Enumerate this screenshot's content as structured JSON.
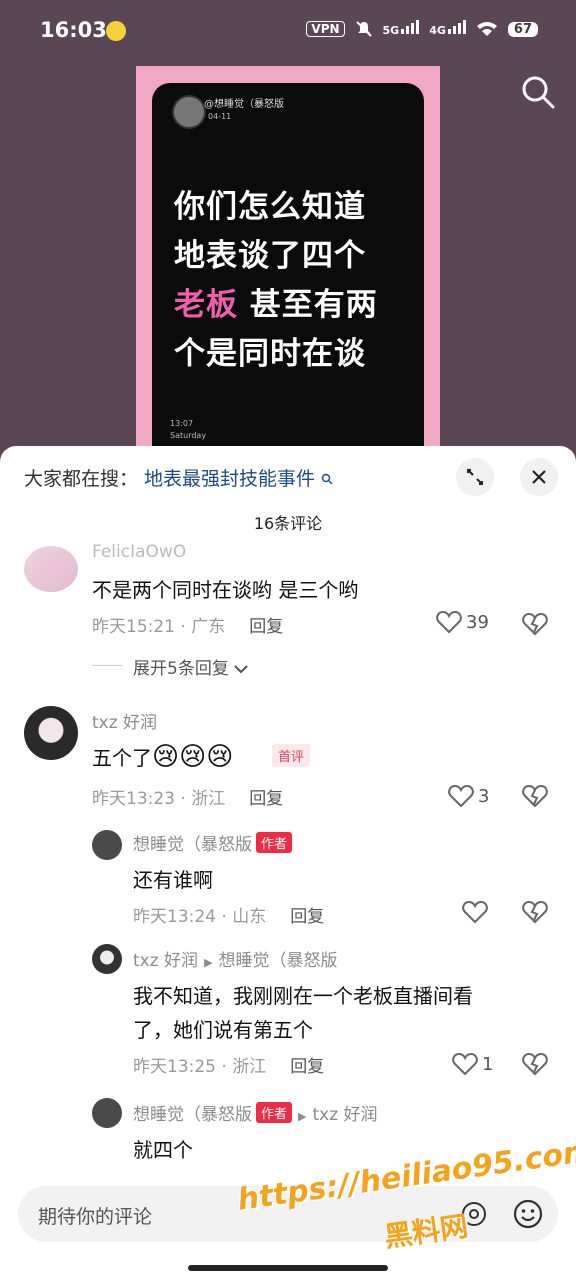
{
  "status": {
    "time": "16:03",
    "vpn": "VPN",
    "net1": "5G",
    "net2": "4G",
    "battery": "67"
  },
  "video": {
    "username": "@想睡觉（暴怒版",
    "date": "04-11",
    "lines": [
      "你们怎么知道",
      "地表谈了四个"
    ],
    "line3_pink": "老板",
    "line3_rest": "甚至有两",
    "line4": "个是同时在谈",
    "time": "13:07",
    "day": "Saturday"
  },
  "sheet": {
    "search_label": "大家都在搜：",
    "search_link": "地表最强封技能事件",
    "count": "16条评论"
  },
  "comments": [
    {
      "nick": "FelicIaOwO",
      "text": "不是两个同时在谈哟 是三个哟",
      "time": "昨天15:21 · 广东",
      "reply": "回复",
      "likes": "39",
      "expand": "展开5条回复"
    },
    {
      "nick": "txz 好润",
      "text": "五个了",
      "emoji": "😢😢😢",
      "badge": "首评",
      "time": "昨天13:23 · 浙江",
      "reply": "回复",
      "likes": "3"
    }
  ],
  "replies": [
    {
      "nick": "想睡觉（暴怒版",
      "badge": "作者",
      "text": "还有谁啊",
      "time": "昨天13:24 · 山东",
      "reply": "回复",
      "likes": ""
    },
    {
      "nick": "txz 好润",
      "to": "想睡觉（暴怒版",
      "text1": "我不知道，我刚刚在一个老板直播间看",
      "text2": "了，她们说有第五个",
      "time": "昨天13:25 · 浙江",
      "reply": "回复",
      "likes": "1"
    },
    {
      "nick": "想睡觉（暴怒版",
      "badge": "作者",
      "to": "txz 好润",
      "text": "就四个"
    }
  ],
  "input": {
    "placeholder": "期待你的评论"
  },
  "watermark": {
    "url": "https://heiliao95.com",
    "name": "黑料网"
  }
}
